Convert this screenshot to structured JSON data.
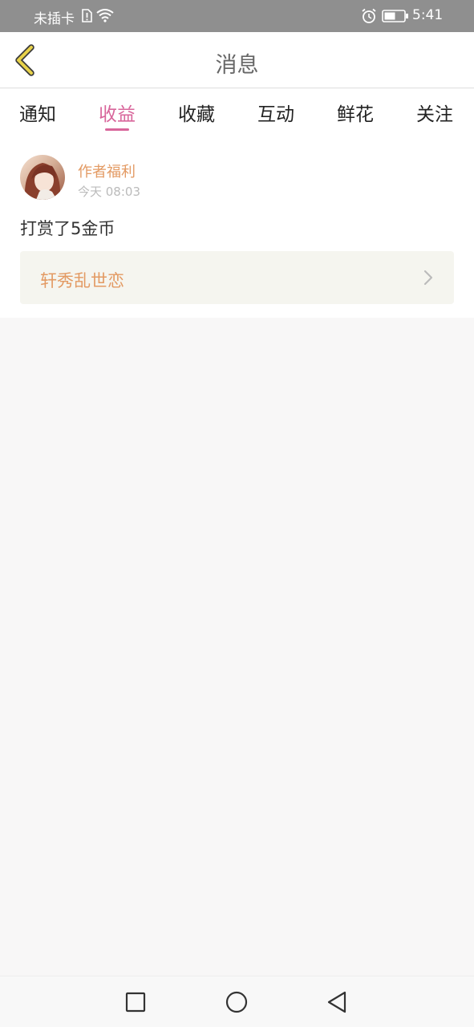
{
  "status_bar": {
    "carrier": "未插卡",
    "time": "5:41",
    "icons": [
      "sim-alert-icon",
      "wifi-icon",
      "alarm-icon",
      "battery-icon"
    ]
  },
  "header": {
    "title": "消息",
    "back_icon": "chevron-left-icon"
  },
  "tabs": [
    {
      "label": "通知",
      "active": false
    },
    {
      "label": "收益",
      "active": true
    },
    {
      "label": "收藏",
      "active": false
    },
    {
      "label": "互动",
      "active": false
    },
    {
      "label": "鲜花",
      "active": false
    },
    {
      "label": "关注",
      "active": false
    }
  ],
  "message": {
    "sender": "作者福利",
    "time": "今天 08:03",
    "text": "打赏了5金币",
    "book_title": "轩秀乱世恋"
  },
  "nav_bar": {
    "icons": [
      "square-recents-icon",
      "circle-home-icon",
      "triangle-back-icon"
    ]
  },
  "colors": {
    "accent": "#d8669b",
    "orange": "#e39a63",
    "status_bar": "#8f8f8f",
    "back_icon": "#e8d24a",
    "card_bg": "#f5f5ef",
    "page_bg": "#f8f7f7"
  }
}
